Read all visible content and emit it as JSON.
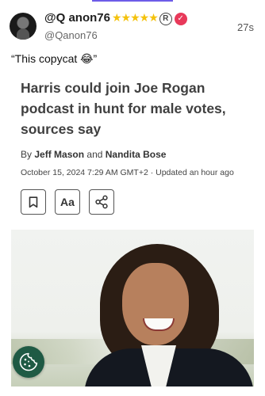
{
  "post": {
    "display_name": "@Q anon76",
    "stars": "★★★★★",
    "registered_mark": "R",
    "verified_mark": "✓",
    "handle": "@Qanon76",
    "timestamp": "27s",
    "text": "“This copycat 😂”"
  },
  "article": {
    "headline": "Harris could join Joe Rogan podcast in hunt for male votes, sources say",
    "byline_prefix": "By",
    "author1": "Jeff Mason",
    "byline_and": "and",
    "author2": "Nandita Bose",
    "dateline": "October 15, 2024 7:29 AM GMT+2 · Updated an hour ago",
    "text_size_label": "Aa"
  },
  "icons": [
    "bookmark-icon",
    "share-icon",
    "cookie-icon"
  ],
  "colors": {
    "accent": "#6d5ce8",
    "star": "#f4c20d",
    "verified": "#e8395a",
    "cookie_button": "#1f5a44"
  }
}
